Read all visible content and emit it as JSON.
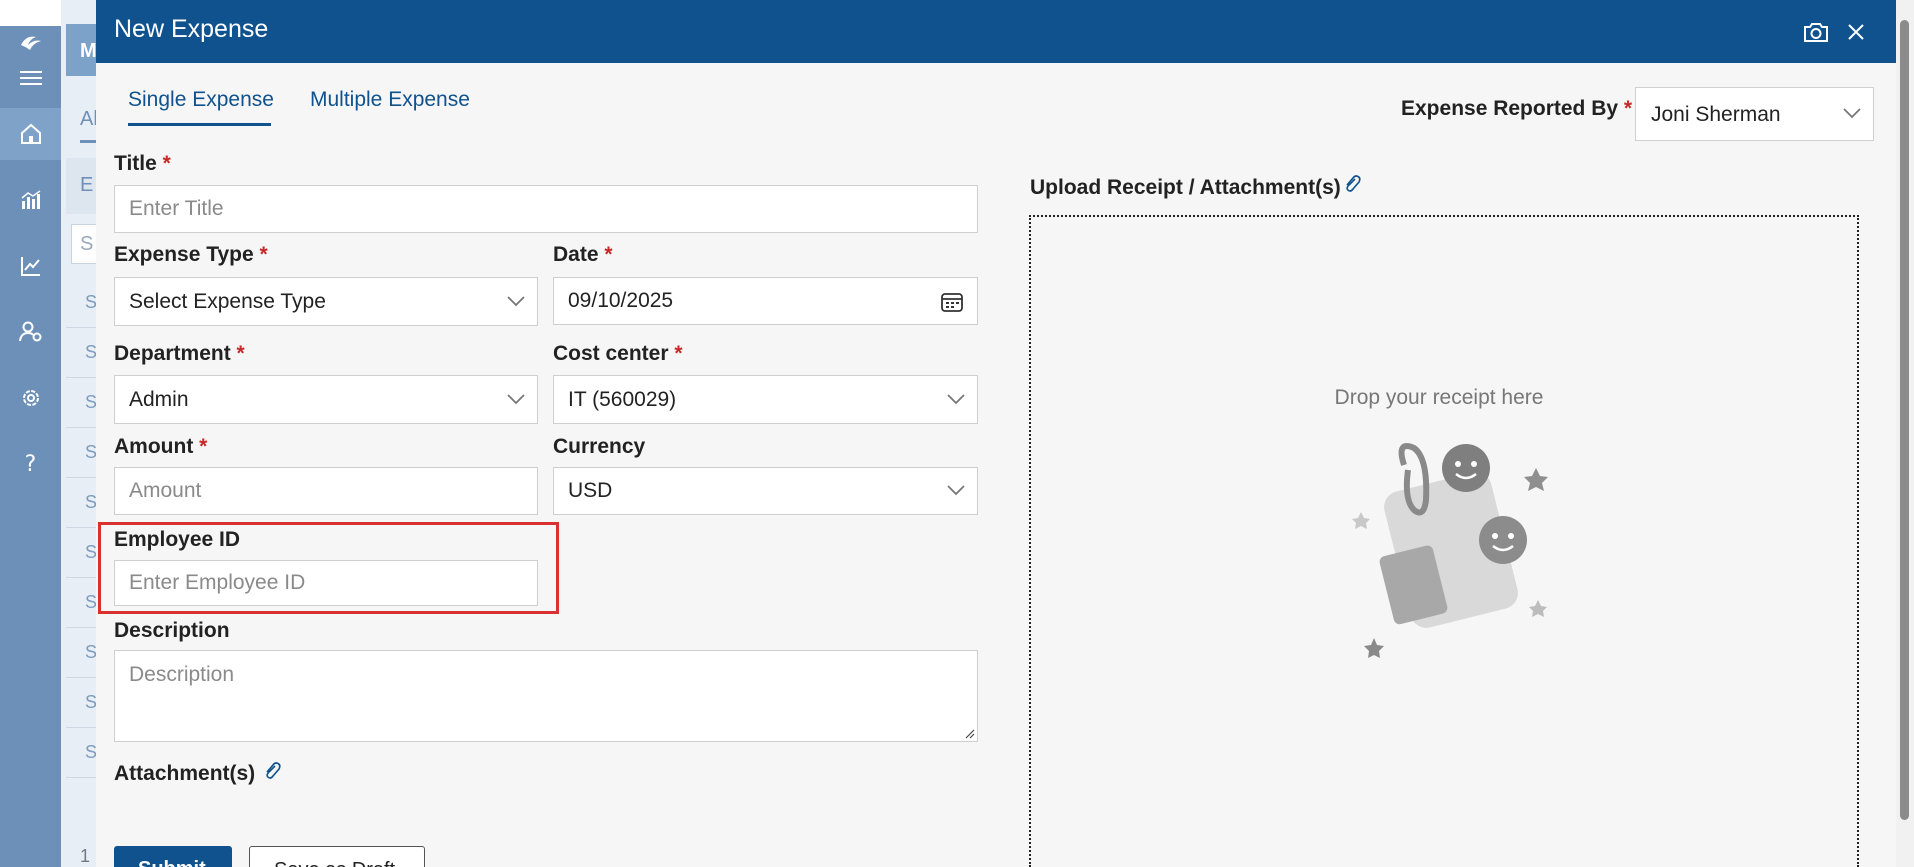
{
  "background_app": {
    "header_letter": "M",
    "tab_letter": "Al",
    "header_row_letter": "E",
    "search_letter": "S",
    "row_letters": [
      "S",
      "S",
      "S",
      "S",
      "S",
      "S",
      "S",
      "S",
      "S",
      "S"
    ],
    "pagination": "1"
  },
  "rail": {
    "icons": [
      "logo-icon",
      "menu-icon",
      "home-icon",
      "analytics-icon",
      "trend-icon",
      "user-settings-icon",
      "gear-icon",
      "help-icon"
    ]
  },
  "modal": {
    "title": "New Expense",
    "tabs": [
      {
        "label": "Single Expense",
        "active": true
      },
      {
        "label": "Multiple Expense",
        "active": false
      }
    ],
    "reported_by": {
      "label": "Expense Reported By",
      "required_mark": "*",
      "value": "Joni Sherman"
    },
    "form": {
      "title": {
        "label": "Title",
        "required_mark": "*",
        "placeholder": "Enter Title"
      },
      "expense_type": {
        "label": "Expense Type",
        "required_mark": "*",
        "value": "Select Expense Type"
      },
      "date": {
        "label": "Date",
        "required_mark": "*",
        "value": "09/10/2025"
      },
      "department": {
        "label": "Department",
        "required_mark": "*",
        "value": "Admin"
      },
      "cost_center": {
        "label": "Cost center",
        "required_mark": "*",
        "value": "IT (560029)"
      },
      "amount": {
        "label": "Amount",
        "required_mark": "*",
        "placeholder": "Amount"
      },
      "currency": {
        "label": "Currency",
        "value": "USD"
      },
      "employee_id": {
        "label": "Employee ID",
        "placeholder": "Enter Employee ID"
      },
      "description": {
        "label": "Description",
        "placeholder": "Description"
      },
      "attachments": {
        "label": "Attachment(s)"
      }
    },
    "upload": {
      "label": "Upload Receipt / Attachment(s)",
      "drop_text": "Drop your receipt here"
    },
    "buttons": {
      "submit": "Submit",
      "draft": "Save as Draft"
    },
    "colors": {
      "header": "#0f528e",
      "required": "#c62828",
      "highlight": "#d93030"
    }
  }
}
